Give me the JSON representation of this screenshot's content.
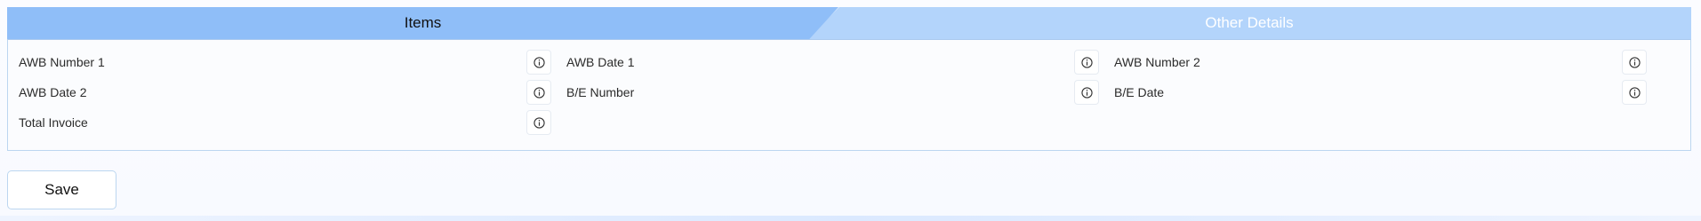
{
  "tabs": {
    "items_label": "Items",
    "other_label": "Other Details"
  },
  "fields": [
    {
      "label": "AWB Number 1"
    },
    {
      "label": "AWB Date 1"
    },
    {
      "label": "AWB Number 2"
    },
    {
      "label": "AWB Date 2"
    },
    {
      "label": "B/E Number"
    },
    {
      "label": "B/E Date"
    },
    {
      "label": "Total Invoice"
    }
  ],
  "icons": {
    "field_info": "info-icon"
  },
  "actions": {
    "save_label": "Save"
  },
  "colors": {
    "tab_active": "#8fbef8",
    "tab_inactive": "#b3d4fb",
    "panel_border": "#bcd6f0"
  }
}
